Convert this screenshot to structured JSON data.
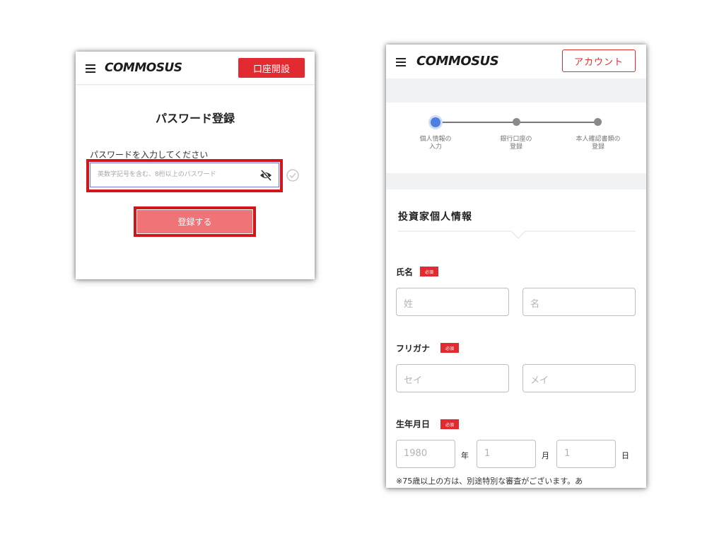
{
  "brand": {
    "logo": "COMMOSUS",
    "accent": "#e12b31",
    "highlight": "#d0151b"
  },
  "left_screen": {
    "header": {
      "menu_icon": "hamburger-icon",
      "open_account_button": "口座開設"
    },
    "title": "パスワード登録",
    "password_label": "パスワードを入力してください",
    "password_placeholder": "英数字記号を含む、8桁以上のパスワード",
    "eye_icon": "eye-off-icon",
    "check_icon": "check-circle-icon",
    "submit_button": "登録する"
  },
  "right_screen": {
    "header": {
      "menu_icon": "hamburger-icon",
      "account_button": "アカウント"
    },
    "steps": [
      {
        "line1": "個人情報の",
        "line2": "入力",
        "active": true
      },
      {
        "line1": "銀行口座の",
        "line2": "登録",
        "active": false
      },
      {
        "line1": "本人確認書類の",
        "line2": "登録",
        "active": false
      }
    ],
    "section_title": "投資家個人情報",
    "required_badge": "必須",
    "name": {
      "label": "氏名",
      "last_placeholder": "姓",
      "first_placeholder": "名"
    },
    "furigana": {
      "label": "フリガナ",
      "last_placeholder": "セイ",
      "first_placeholder": "メイ"
    },
    "birthdate": {
      "label": "生年月日",
      "year_placeholder": "1980",
      "year_unit": "年",
      "month_placeholder": "1",
      "month_unit": "月",
      "day_placeholder": "1",
      "day_unit": "日"
    },
    "note": "※75歳以上の方は、別途特別な審査がございます。あ"
  }
}
